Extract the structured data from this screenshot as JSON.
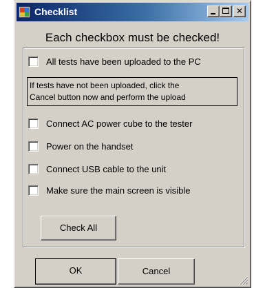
{
  "window": {
    "title": "Checklist",
    "controls": {
      "minimize": "",
      "maximize": "",
      "close": "✕"
    }
  },
  "heading": "Each checkbox must be checked!",
  "items": [
    {
      "label": "All tests have been uploaded to the PC",
      "checked": false
    },
    {
      "label": "Connect AC power cube to the tester",
      "checked": false
    },
    {
      "label": "Power on the handset",
      "checked": false
    },
    {
      "label": "Connect USB cable to the unit",
      "checked": false
    },
    {
      "label": "Make sure the main screen is visible",
      "checked": false
    }
  ],
  "note": {
    "line1": "If tests have not been uploaded, click the",
    "line2": "Cancel button now and perform the upload"
  },
  "buttons": {
    "check_all": "Check All",
    "ok": "OK",
    "cancel": "Cancel"
  }
}
